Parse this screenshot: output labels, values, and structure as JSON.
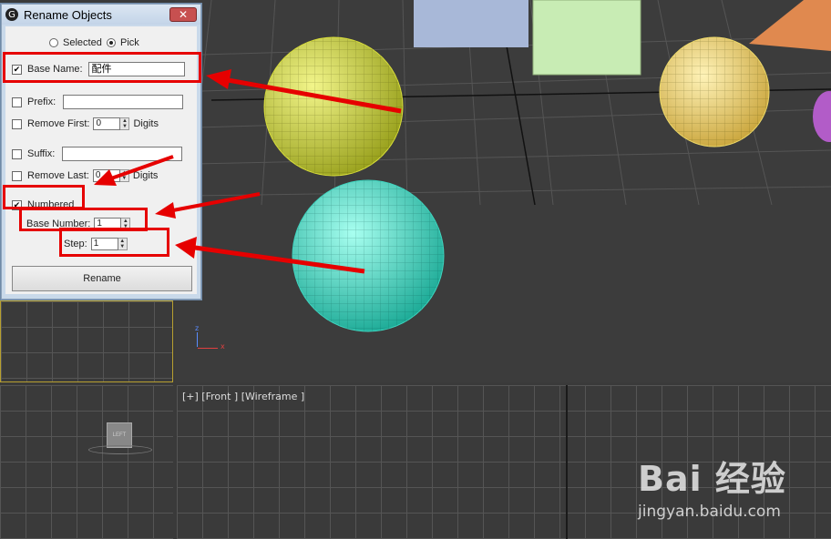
{
  "dialog": {
    "title": "Rename Objects",
    "close_label": "✕",
    "mode_selected_label": "Selected",
    "mode_pick_label": "Pick",
    "base_name_label": "Base Name:",
    "base_name_value": "配件",
    "prefix_label": "Prefix:",
    "prefix_value": "",
    "remove_first_label": "Remove First:",
    "remove_first_value": "0",
    "digits_label": "Digits",
    "suffix_label": "Suffix:",
    "suffix_value": "",
    "remove_last_label": "Remove Last:",
    "remove_last_value": "0",
    "numbered_label": "Numbered",
    "base_number_label": "Base Number:",
    "base_number_value": "1",
    "step_label": "Step:",
    "step_value": "1",
    "rename_label": "Rename",
    "checked_mark": "✔",
    "state": {
      "base_name_checked": true,
      "prefix_checked": false,
      "remove_first_checked": false,
      "suffix_checked": false,
      "remove_last_checked": false,
      "numbered_checked": true,
      "mode": "Pick"
    }
  },
  "viewports": {
    "front_label": "[+] [Front ] [Wireframe ]",
    "viewcube_label": "LEFT",
    "axis_z": "z",
    "axis_x": "x"
  },
  "watermark": {
    "brand": "Bai 经验",
    "url": "jingyan.baidu.com"
  },
  "colors": {
    "highlight": "#e60000",
    "sphere_yellow_green": "#c8cf3a",
    "sphere_cyan": "#3fd6c0",
    "sphere_yellow": "#e6cf6a",
    "cone_orange": "#e0894f",
    "box_green": "#c8ecb4",
    "cylinder_blue": "#a8b8d8"
  }
}
